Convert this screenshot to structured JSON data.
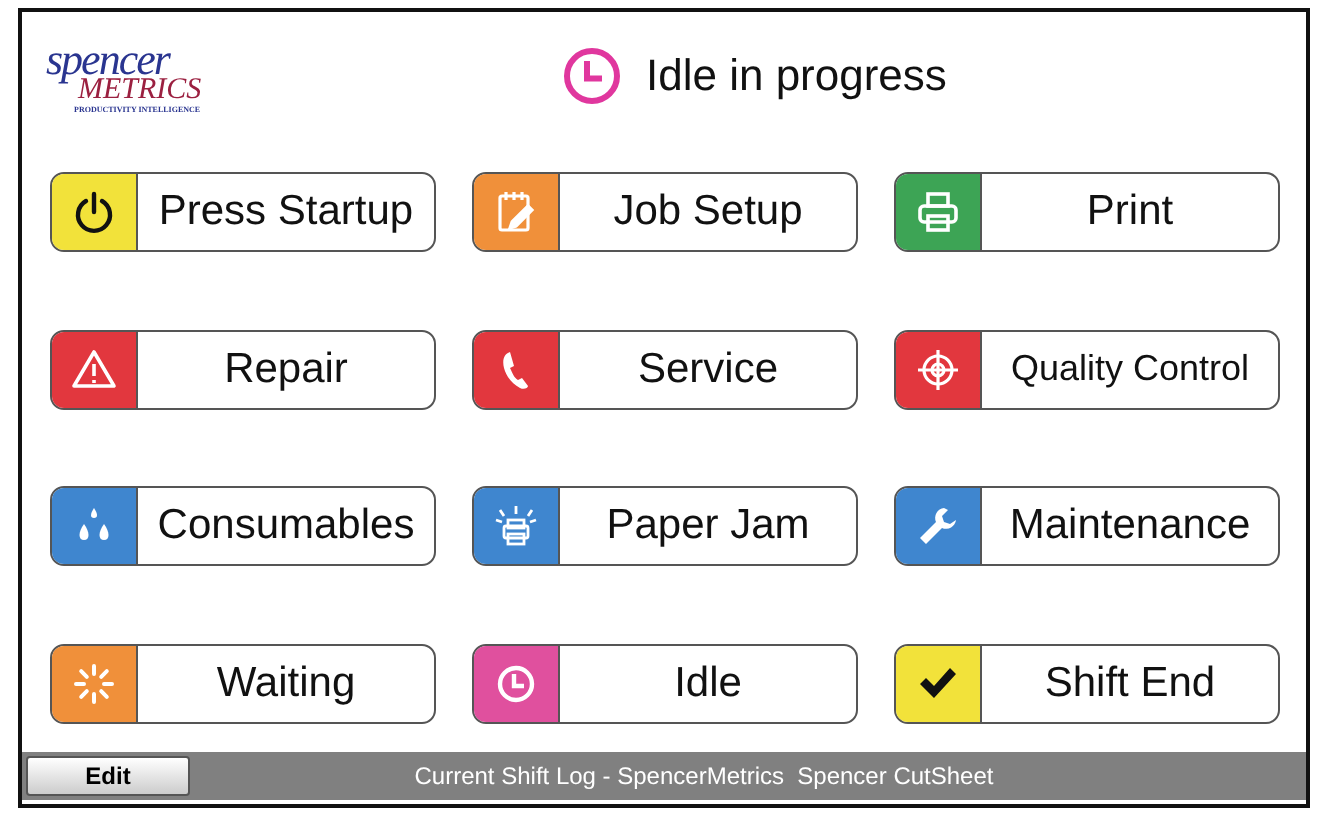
{
  "logo": {
    "line_1": "spencer",
    "line_2": "METRICS",
    "tagline": "PRODUCTIVITY INTELLIGENCE"
  },
  "status": {
    "text": "Idle in progress"
  },
  "buttons": [
    {
      "label": "Press Startup",
      "kind": "power",
      "color": "#f2e23a"
    },
    {
      "label": "Job Setup",
      "kind": "notepad",
      "color": "#f0903a"
    },
    {
      "label": "Print",
      "kind": "printer",
      "color": "#3da455"
    },
    {
      "label": "Repair",
      "kind": "warning",
      "color": "#e2373e"
    },
    {
      "label": "Service",
      "kind": "phone",
      "color": "#e2373e"
    },
    {
      "label": "Quality Control",
      "kind": "target",
      "color": "#e2373e"
    },
    {
      "label": "Consumables",
      "kind": "drops",
      "color": "#3f86cf"
    },
    {
      "label": "Paper Jam",
      "kind": "jam",
      "color": "#3f86cf"
    },
    {
      "label": "Maintenance",
      "kind": "wrench",
      "color": "#3f86cf"
    },
    {
      "label": "Waiting",
      "kind": "spinner",
      "color": "#f0903a"
    },
    {
      "label": "Idle",
      "kind": "clock",
      "color": "#e0509e"
    },
    {
      "label": "Shift End",
      "kind": "check",
      "color": "#f2e23a"
    }
  ],
  "footer": {
    "edit_button": "Edit",
    "text": "Current Shift Log - SpencerMetrics  Spencer CutSheet"
  }
}
